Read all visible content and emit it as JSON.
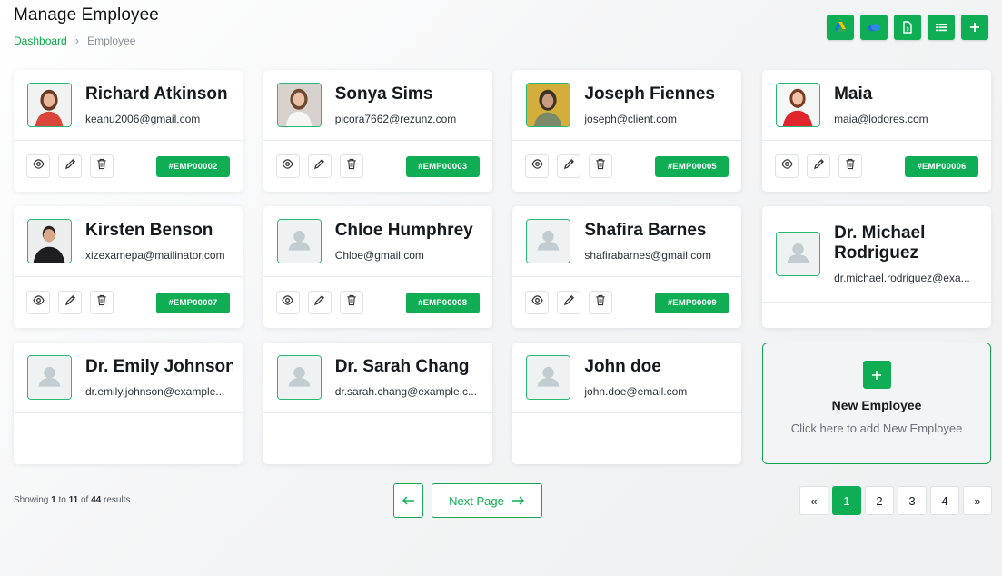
{
  "page": {
    "title": "Manage Employee",
    "breadcrumb": {
      "home": "Dashboard",
      "current": "Employee"
    }
  },
  "toolbar": {
    "buttons": [
      "google-drive-icon",
      "onedrive-icon",
      "export-file-icon",
      "list-view-icon",
      "add-icon"
    ]
  },
  "colors": {
    "accent": "#0fae55",
    "border_green": "#2bb673"
  },
  "employees": [
    {
      "name": "Richard Atkinson",
      "email": "keanu2006@gmail.com",
      "id": "#EMP00002",
      "photo": "woman-red"
    },
    {
      "name": "Sonya Sims",
      "email": "picora7662@rezunz.com",
      "id": "#EMP00003",
      "photo": "woman-white"
    },
    {
      "name": "Joseph Fiennes",
      "email": "joseph@client.com",
      "id": "#EMP00005",
      "photo": "woman-yellow"
    },
    {
      "name": "Maia",
      "email": "maia@lodores.com",
      "id": "#EMP00006",
      "photo": "woman-red2"
    },
    {
      "name": "Kirsten Benson",
      "email": "xizexamepa@mailinator.com",
      "id": "#EMP00007",
      "photo": "man-dark"
    },
    {
      "name": "Chloe Humphrey",
      "email": "Chloe@gmail.com",
      "id": "#EMP00008",
      "photo": "placeholder"
    },
    {
      "name": "Shafira Barnes",
      "email": "shafirabarnes@gmail.com",
      "id": "#EMP00009",
      "photo": "placeholder"
    },
    {
      "name": "Dr. Michael Rodriguez",
      "email": "dr.michael.rodriguez@exa...",
      "id": "",
      "photo": "placeholder"
    },
    {
      "name": "Dr. Emily Johnson",
      "email": "dr.emily.johnson@example...",
      "id": "",
      "photo": "placeholder"
    },
    {
      "name": "Dr. Sarah Chang",
      "email": "dr.sarah.chang@example.c...",
      "id": "",
      "photo": "placeholder"
    },
    {
      "name": "John doe",
      "email": "john.doe@email.com",
      "id": "",
      "photo": "placeholder"
    }
  ],
  "new_employee": {
    "title": "New Employee",
    "subtitle": "Click here to add New Employee"
  },
  "results": {
    "prefix": "Showing",
    "from": "1",
    "to_word": "to",
    "to": "11",
    "of_word": "of",
    "total": "44",
    "suffix": "results"
  },
  "nav": {
    "next_label": "Next Page"
  },
  "pagination": {
    "first": "«",
    "last": "»",
    "pages": [
      "1",
      "2",
      "3",
      "4"
    ],
    "active": "1"
  }
}
